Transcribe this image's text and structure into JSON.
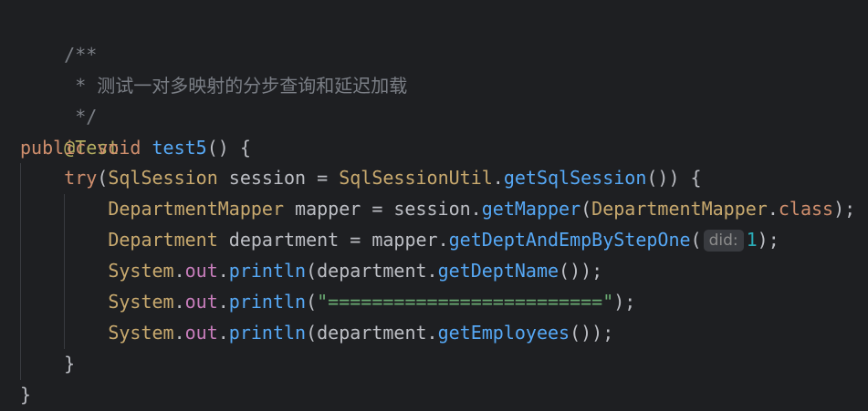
{
  "editor": {
    "comment": {
      "open": "/**",
      "body": " * 测试一对多映射的分步查询和延迟加载",
      "close": " */"
    },
    "annotation": "@Test",
    "method_decl": {
      "modifier": "public",
      "return_type": "void",
      "name": "test5",
      "rest": "() {"
    },
    "try_line": {
      "keyword": "try",
      "open_paren": "(",
      "type": "SqlSession",
      "var": " session = ",
      "util_class": "SqlSessionUtil",
      "dot": ".",
      "method": "getSqlSession",
      "rest": "()) {"
    },
    "mapper_line": {
      "type": "DepartmentMapper",
      "var": " mapper = session.",
      "method": "getMapper",
      "open_paren": "(",
      "arg_class": "DepartmentMapper",
      "dot": ".",
      "class_kw": "class",
      "rest": ");"
    },
    "dept_line": {
      "type": "Department",
      "var": " department = mapper.",
      "method": "getDeptAndEmpByStepOne",
      "open_paren": "(",
      "hint": "did:",
      "arg": "1",
      "rest": ");"
    },
    "print1": {
      "class": "System",
      "dot1": ".",
      "field": "out",
      "dot2": ".",
      "method": "println",
      "arg_pre": "(department.",
      "arg_method": "getDeptName",
      "rest": "());"
    },
    "print2": {
      "class": "System",
      "dot1": ".",
      "field": "out",
      "dot2": ".",
      "method": "println",
      "open_paren": "(",
      "string": "\"=========================\"",
      "rest": ");"
    },
    "print3": {
      "class": "System",
      "dot1": ".",
      "field": "out",
      "dot2": ".",
      "method": "println",
      "arg_pre": "(department.",
      "arg_method": "getEmployees",
      "rest": "());"
    },
    "close_try": "}",
    "close_method": "}"
  }
}
